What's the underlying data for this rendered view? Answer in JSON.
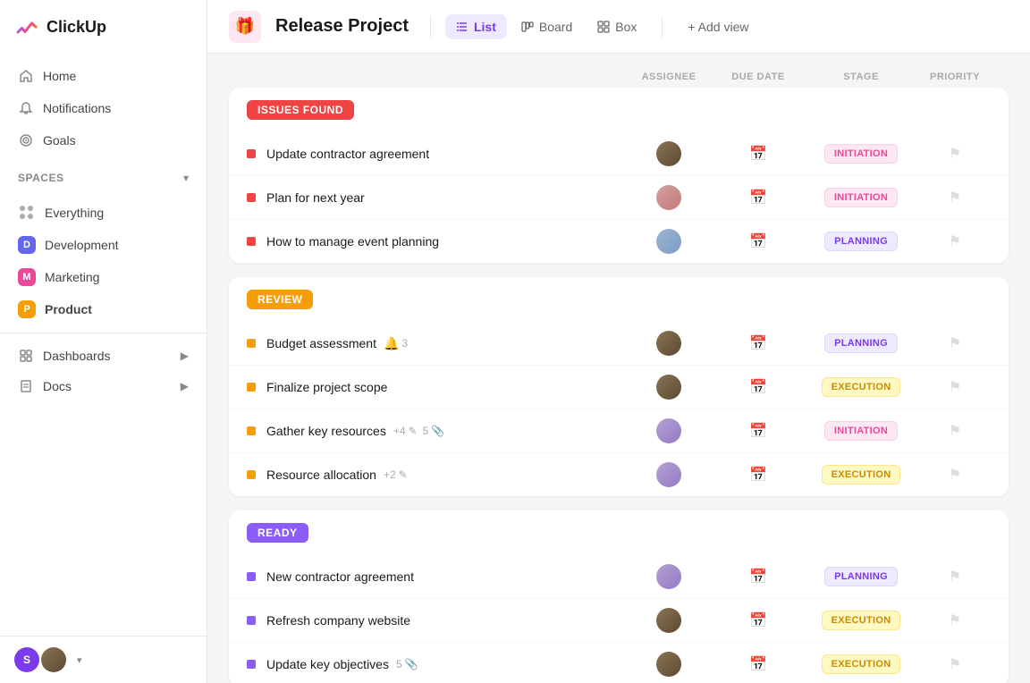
{
  "app": {
    "name": "ClickUp"
  },
  "sidebar": {
    "nav": [
      {
        "id": "home",
        "label": "Home",
        "icon": "home"
      },
      {
        "id": "notifications",
        "label": "Notifications",
        "icon": "bell"
      },
      {
        "id": "goals",
        "label": "Goals",
        "icon": "trophy"
      }
    ],
    "spaces_label": "Spaces",
    "spaces": [
      {
        "id": "everything",
        "label": "Everything",
        "color": null,
        "letter": null
      },
      {
        "id": "development",
        "label": "Development",
        "color": "#6366f1",
        "letter": "D"
      },
      {
        "id": "marketing",
        "label": "Marketing",
        "color": "#ec4899",
        "letter": "M"
      },
      {
        "id": "product",
        "label": "Product",
        "color": "#f59e0b",
        "letter": "P",
        "active": true
      }
    ],
    "sections": [
      {
        "id": "dashboards",
        "label": "Dashboards",
        "hasChevron": true
      },
      {
        "id": "docs",
        "label": "Docs",
        "hasChevron": true
      }
    ]
  },
  "project": {
    "title": "Release Project",
    "icon": "🎁"
  },
  "views": [
    {
      "id": "list",
      "label": "List",
      "active": true,
      "icon": "list"
    },
    {
      "id": "board",
      "label": "Board",
      "active": false,
      "icon": "board"
    },
    {
      "id": "box",
      "label": "Box",
      "active": false,
      "icon": "box"
    }
  ],
  "add_view_label": "+ Add view",
  "columns": {
    "assignee": "ASSIGNEE",
    "due_date": "DUE DATE",
    "stage": "STAGE",
    "priority": "PRIORITY"
  },
  "groups": [
    {
      "id": "issues-found",
      "label": "ISSUES FOUND",
      "color": "#ef4444",
      "tasks": [
        {
          "name": "Update contractor agreement",
          "indicator": "red",
          "assignee": "face-1",
          "stage": "INITIATION",
          "stage_class": "stage-initiation",
          "meta": []
        },
        {
          "name": "Plan for next year",
          "indicator": "red",
          "assignee": "face-2",
          "stage": "INITIATION",
          "stage_class": "stage-initiation",
          "meta": []
        },
        {
          "name": "How to manage event planning",
          "indicator": "red",
          "assignee": "face-3",
          "stage": "PLANNING",
          "stage_class": "stage-planning",
          "meta": []
        }
      ]
    },
    {
      "id": "review",
      "label": "REVIEW",
      "color": "#f59e0b",
      "tasks": [
        {
          "name": "Budget assessment",
          "indicator": "yellow",
          "assignee": "face-1",
          "stage": "PLANNING",
          "stage_class": "stage-planning",
          "meta": [
            {
              "type": "count",
              "value": "3",
              "icon": "🔔"
            }
          ]
        },
        {
          "name": "Finalize project scope",
          "indicator": "yellow",
          "assignee": "face-1",
          "stage": "EXECUTION",
          "stage_class": "stage-execution",
          "meta": []
        },
        {
          "name": "Gather key resources",
          "indicator": "yellow",
          "assignee": "face-4",
          "stage": "INITIATION",
          "stage_class": "stage-initiation",
          "meta": [
            {
              "type": "count",
              "value": "+4",
              "icon": "✎"
            },
            {
              "type": "count",
              "value": "5",
              "icon": "📎"
            }
          ]
        },
        {
          "name": "Resource allocation",
          "indicator": "yellow",
          "assignee": "face-4",
          "stage": "EXECUTION",
          "stage_class": "stage-execution",
          "meta": [
            {
              "type": "count",
              "value": "+2",
              "icon": "✎"
            }
          ]
        }
      ]
    },
    {
      "id": "ready",
      "label": "READY",
      "color": "#8b5cf6",
      "tasks": [
        {
          "name": "New contractor agreement",
          "indicator": "purple",
          "assignee": "face-4",
          "stage": "PLANNING",
          "stage_class": "stage-planning",
          "meta": []
        },
        {
          "name": "Refresh company website",
          "indicator": "purple",
          "assignee": "face-1",
          "stage": "EXECUTION",
          "stage_class": "stage-execution",
          "meta": []
        },
        {
          "name": "Update key objectives",
          "indicator": "purple",
          "assignee": "face-1",
          "stage": "EXECUTION",
          "stage_class": "stage-execution",
          "meta": [
            {
              "type": "count",
              "value": "5",
              "icon": "📎"
            }
          ]
        }
      ]
    }
  ]
}
